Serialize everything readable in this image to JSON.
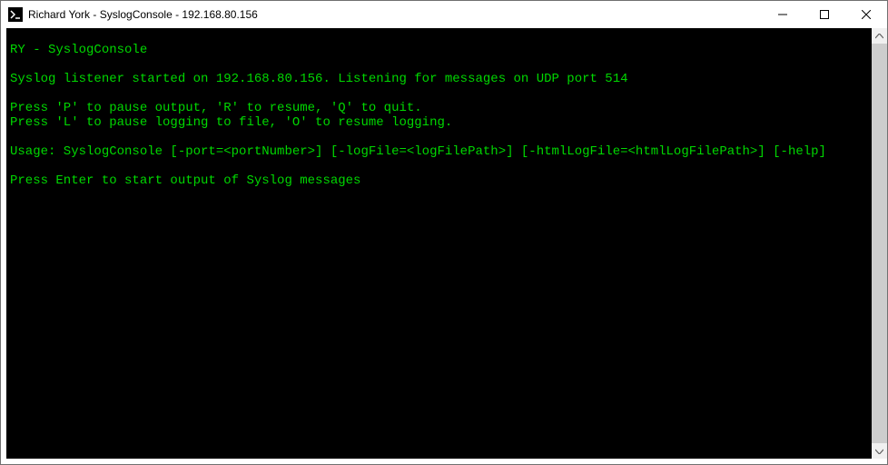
{
  "window": {
    "title": "Richard York - SyslogConsole - 192.168.80.156"
  },
  "console": {
    "lines": [
      "",
      "RY - SyslogConsole",
      "",
      "Syslog listener started on 192.168.80.156. Listening for messages on UDP port 514",
      "",
      "Press 'P' to pause output, 'R' to resume, 'Q' to quit.",
      "Press 'L' to pause logging to file, 'O' to resume logging.",
      "",
      "Usage: SyslogConsole [-port=<portNumber>] [-logFile=<logFilePath>] [-htmlLogFile=<htmlLogFilePath>] [-help]",
      "",
      "Press Enter to start output of Syslog messages"
    ]
  }
}
